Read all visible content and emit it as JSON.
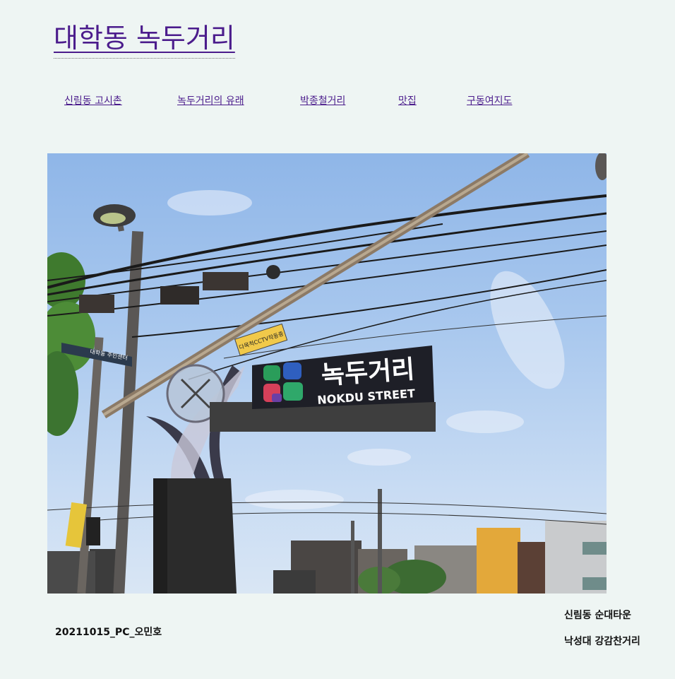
{
  "site": {
    "title": "대학동 녹두거리"
  },
  "nav": {
    "items": [
      {
        "label": "신림동 고시촌"
      },
      {
        "label": "녹두거리의 유래"
      },
      {
        "label": "박종철거리"
      },
      {
        "label": "맛집"
      },
      {
        "label": "구동여지도"
      }
    ]
  },
  "photo": {
    "sign_korean": "녹두거리",
    "sign_english": "NOKDU STREET",
    "small_sign": "다목적CCTV작동중",
    "direction_sign": "대학동 주민센터"
  },
  "footer": {
    "credit": "20211015_PC_오민호",
    "related": [
      {
        "label": "신림동 순대타운"
      },
      {
        "label": "낙성대 강감찬거리"
      }
    ]
  },
  "colors": {
    "background": "#eef5f3",
    "link": "#4b1c8c"
  }
}
